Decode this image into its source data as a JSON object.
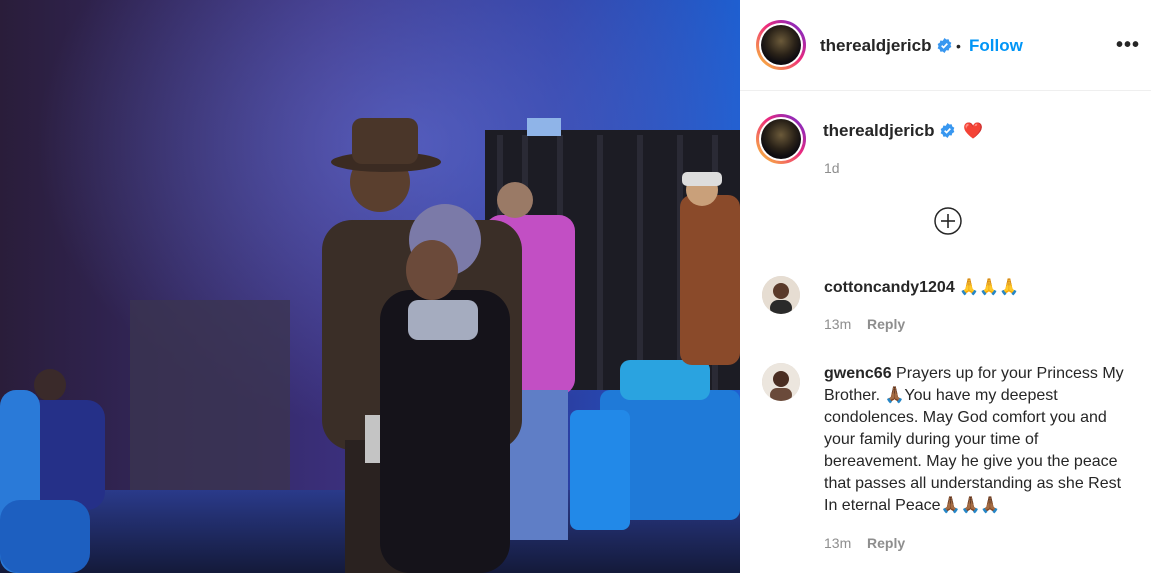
{
  "colors": {
    "link": "#0095f6",
    "verified": "#3897f0",
    "muted": "#8e8e8e",
    "heart": "#ed1c24"
  },
  "media": {
    "description_icon": "video-frame"
  },
  "header": {
    "username": "therealdjericb",
    "separator": "•",
    "follow_label": "Follow",
    "more_label": "•••"
  },
  "caption": {
    "username": "therealdjericb",
    "emoji": "❤️",
    "time": "1d"
  },
  "load_more_icon": "plus-circle-icon",
  "comments": [
    {
      "username": "cottoncandy1204",
      "text": "🙏🙏🙏",
      "time": "13m",
      "reply_label": "Reply"
    },
    {
      "username": "gwenc66",
      "text": "Prayers up for your Princess My Brother. 🙏🏾You have my deepest condolences. May God comfort you and your family during your time of bereavement. May he give you the peace that passes all understanding as she Rest In eternal Peace🙏🏾🙏🏾🙏🏾",
      "time": "13m",
      "reply_label": "Reply"
    }
  ]
}
